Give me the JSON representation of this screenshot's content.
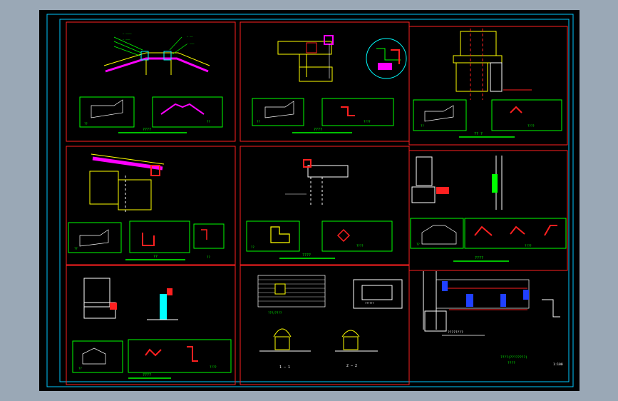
{
  "canvas": {
    "background": "#000000",
    "viewport_bg": "#9aa8b6"
  },
  "colors": {
    "border_outer": "#00ffff",
    "panel_border": "#ff2020",
    "roof": "#ff00ff",
    "detail": "#ffff00",
    "dim": "#ffffff",
    "inset": "#00ff00",
    "cyan": "#00ffff",
    "blue": "#2040ff",
    "red": "#ff2020"
  },
  "panels": [
    {
      "id": "p1",
      "caption": "????",
      "note_a": "??",
      "note_b": "??"
    },
    {
      "id": "p2",
      "caption": "????",
      "note_a": "??",
      "note_b": "????"
    },
    {
      "id": "p3",
      "caption": "?? ?",
      "note_a": "??",
      "note_b": "????"
    },
    {
      "id": "p4",
      "caption": "??",
      "note_a": "??",
      "note_b": "??"
    },
    {
      "id": "p5",
      "caption": "????",
      "note_a": "??",
      "note_b": "????"
    },
    {
      "id": "p6",
      "caption": "????",
      "note_a": "??",
      "note_b": "????"
    },
    {
      "id": "p7",
      "caption": "????",
      "note_a": "??",
      "note_b": "????"
    },
    {
      "id": "p8",
      "caption_a": "???/????",
      "caption_b": "1 — 1",
      "caption_c": "2 — 2",
      "box_label": "??????"
    },
    {
      "id": "p9",
      "caption_a": "????????",
      "caption_b": "????(????????)",
      "caption_c": "????",
      "sheet_no": "1:100"
    }
  ]
}
